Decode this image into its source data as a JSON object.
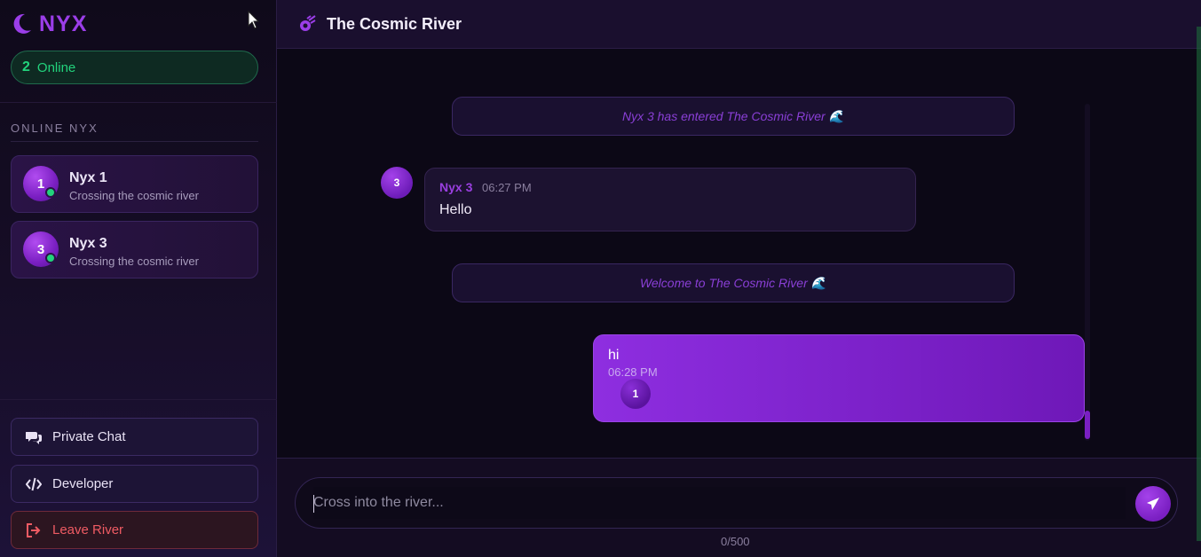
{
  "brand": {
    "name": "NYX"
  },
  "online": {
    "count": "2",
    "label": "Online"
  },
  "sidebar": {
    "section_title": "ONLINE NYX",
    "users": [
      {
        "avatar": "1",
        "name": "Nyx 1",
        "status": "Crossing the cosmic river"
      },
      {
        "avatar": "3",
        "name": "Nyx 3",
        "status": "Crossing the cosmic river"
      }
    ],
    "buttons": {
      "private_chat": "Private Chat",
      "developer": "Developer",
      "leave": "Leave River"
    }
  },
  "header": {
    "room_title": "The Cosmic River"
  },
  "messages": {
    "system_1": "Nyx 3 has entered The Cosmic River 🌊",
    "incoming": {
      "avatar": "3",
      "sender": "Nyx 3",
      "time": "06:27 PM",
      "text": "Hello"
    },
    "system_2": "Welcome to The Cosmic River 🌊",
    "outgoing": {
      "text": "hi",
      "time": "06:28 PM",
      "read_by": "1"
    }
  },
  "composer": {
    "placeholder": "Cross into the river...",
    "value": "",
    "char_count": "0/500"
  },
  "colors": {
    "accent": "#9b3ee8",
    "online_green": "#22d37c",
    "danger": "#ef5b63"
  },
  "icons": {
    "brand": "crescent-moon-icon",
    "room": "meteor-icon",
    "private_chat": "chat-bubbles-icon",
    "developer": "code-icon",
    "leave": "sign-out-icon",
    "send": "paper-plane-icon"
  }
}
